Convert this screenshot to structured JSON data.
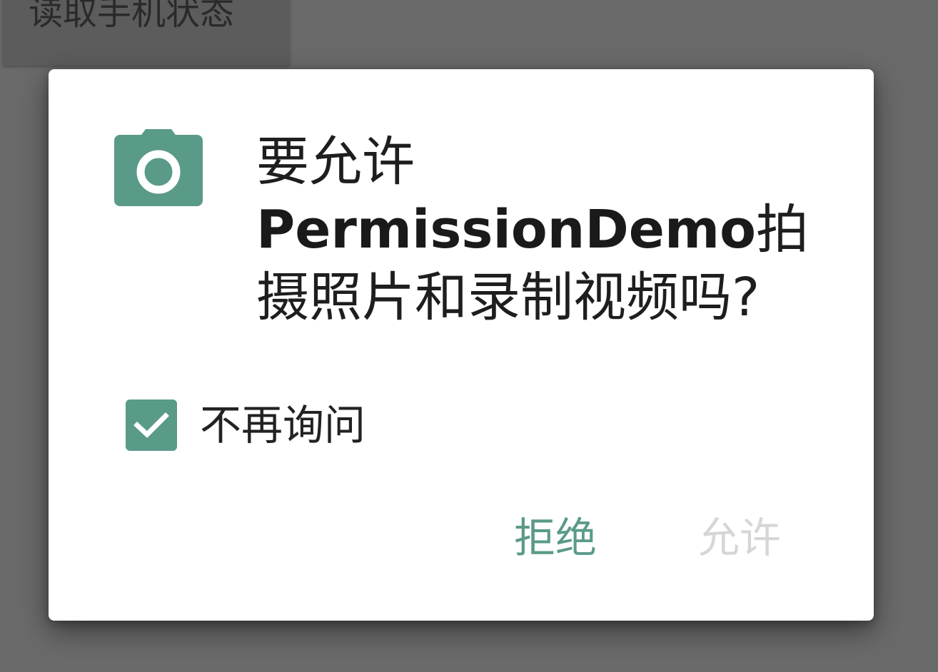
{
  "background": {
    "button_label": "读取手机状态"
  },
  "dialog": {
    "icon": "camera-icon",
    "message": {
      "prefix": "要允许",
      "app_name": "PermissionDemo",
      "suffix": "拍摄照片和录制视频吗?"
    },
    "dont_ask_again": {
      "label": "不再询问",
      "checked": true
    },
    "buttons": {
      "deny": "拒绝",
      "allow": "允许"
    }
  },
  "colors": {
    "accent": "#5a9a89",
    "scrim": "#6a6a6a",
    "disabled_text": "#d6d6d6"
  }
}
